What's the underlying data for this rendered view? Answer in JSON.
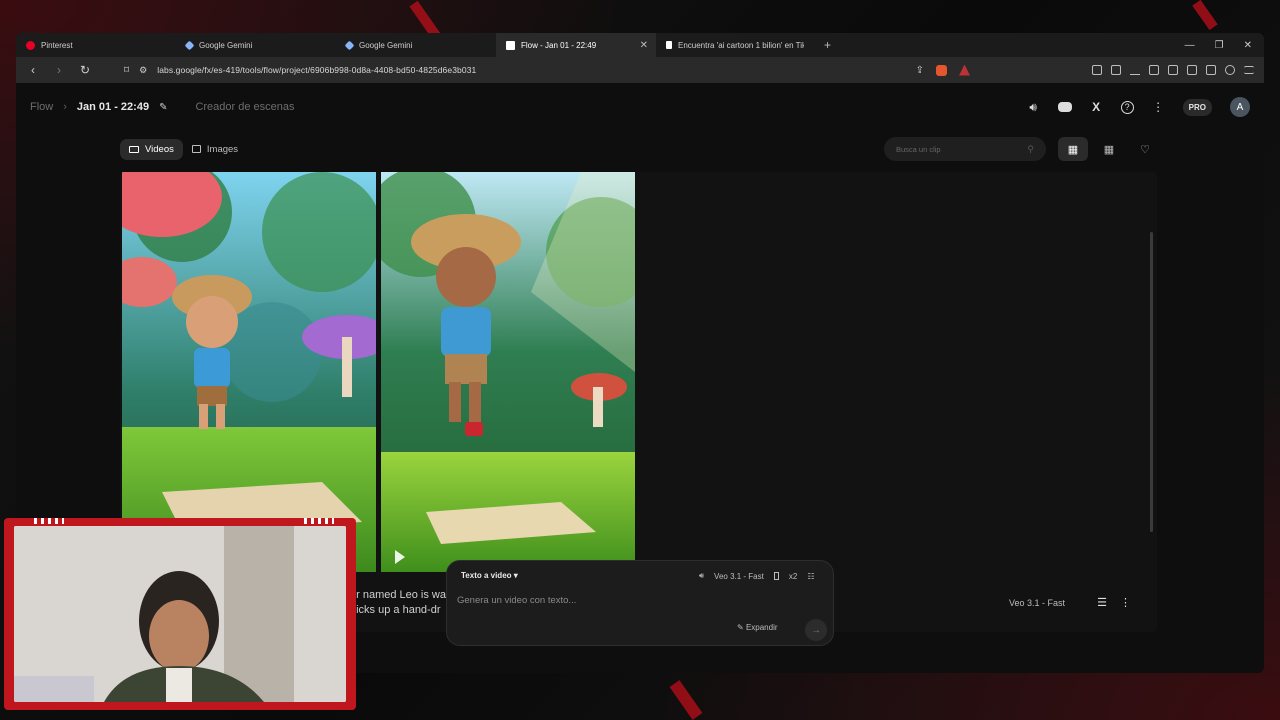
{
  "browser": {
    "tabs": [
      {
        "label": "Pinterest",
        "favicon_color": "#e60023",
        "active": false
      },
      {
        "label": "Google Gemini",
        "favicon_color": "#8ab4f8",
        "active": false
      },
      {
        "label": "Google Gemini",
        "favicon_color": "#8ab4f8",
        "active": false
      },
      {
        "label": "Flow - Jan 01 - 22:49",
        "favicon_color": "#ffffff",
        "active": true
      },
      {
        "label": "Encuentra 'ai cartoon 1 bilion' en Tik",
        "favicon_color": "#ffffff",
        "active": false
      }
    ],
    "url": "labs.google/fx/es-419/tools/flow/project/6906b998-0d8a-4408-bd50-4825d6e3b031"
  },
  "header": {
    "breadcrumb_root": "Flow",
    "project_title": "Jan 01 - 22:49",
    "scene_builder": "Creador de escenas",
    "pro_badge": "PRO",
    "avatar_initial": "A"
  },
  "toolbar": {
    "tabs": [
      {
        "label": "Videos",
        "active": true
      },
      {
        "label": "Images",
        "active": false
      }
    ],
    "search_placeholder": "Busca un clip"
  },
  "content": {
    "caption_line1": "er named Leo is wa",
    "caption_line2": "picks up a hand-dr",
    "model_label": "Veo 3.1 - Fast"
  },
  "prompt": {
    "mode": "Texto a video",
    "model": "Veo 3.1 - Fast",
    "count": "x2",
    "placeholder": "Genera un video con texto...",
    "expand_label": "Expandir"
  },
  "colors": {
    "accent_red": "#c0171f",
    "background": "#0e0e0f"
  }
}
